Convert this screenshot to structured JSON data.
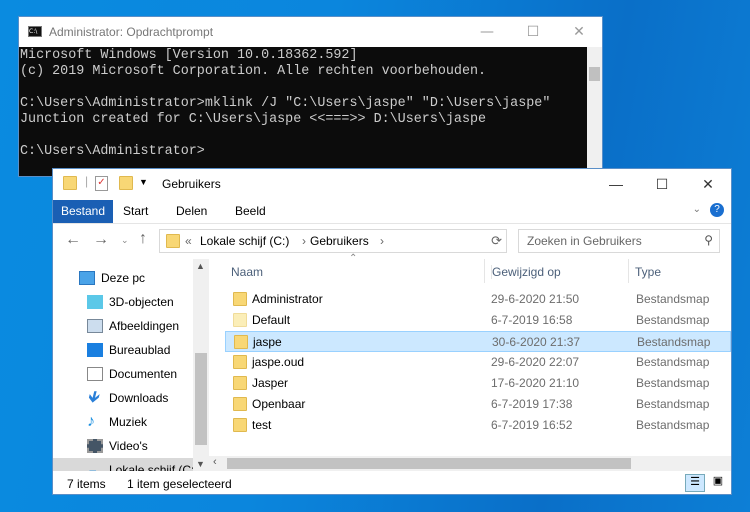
{
  "cmd": {
    "title": "Administrator: Opdrachtprompt",
    "lines": [
      "Microsoft Windows [Version 10.0.18362.592]",
      "(c) 2019 Microsoft Corporation. Alle rechten voorbehouden.",
      "",
      "C:\\Users\\Administrator>mklink /J \"C:\\Users\\jaspe\" \"D:\\Users\\jaspe\"",
      "Junction created for C:\\Users\\jaspe <<===>> D:\\Users\\jaspe",
      "",
      "C:\\Users\\Administrator>"
    ]
  },
  "explorer": {
    "title": "Gebruikers",
    "tabs": [
      "Bestand",
      "Start",
      "Delen",
      "Beeld"
    ],
    "address": {
      "prefix": "«",
      "parts": [
        "Lokale schijf (C:)",
        "Gebruikers"
      ]
    },
    "search_placeholder": "Zoeken in Gebruikers",
    "nav": [
      "Deze pc",
      "3D-objecten",
      "Afbeeldingen",
      "Bureaublad",
      "Documenten",
      "Downloads",
      "Muziek",
      "Video's",
      "Lokale schijf (C:)"
    ],
    "columns": [
      "Naam",
      "Gewijzigd op",
      "Type"
    ],
    "files": [
      {
        "name": "Administrator",
        "date": "29-6-2020 21:50",
        "type": "Bestandsmap"
      },
      {
        "name": "Default",
        "date": "6-7-2019 16:58",
        "type": "Bestandsmap"
      },
      {
        "name": "jaspe",
        "date": "30-6-2020 21:37",
        "type": "Bestandsmap",
        "selected": true
      },
      {
        "name": "jaspe.oud",
        "date": "29-6-2020 22:07",
        "type": "Bestandsmap"
      },
      {
        "name": "Jasper",
        "date": "17-6-2020 21:10",
        "type": "Bestandsmap"
      },
      {
        "name": "Openbaar",
        "date": "6-7-2019 17:38",
        "type": "Bestandsmap"
      },
      {
        "name": "test",
        "date": "6-7-2019 16:52",
        "type": "Bestandsmap"
      }
    ],
    "status": {
      "count": "7 items",
      "selection": "1 item geselecteerd"
    }
  }
}
